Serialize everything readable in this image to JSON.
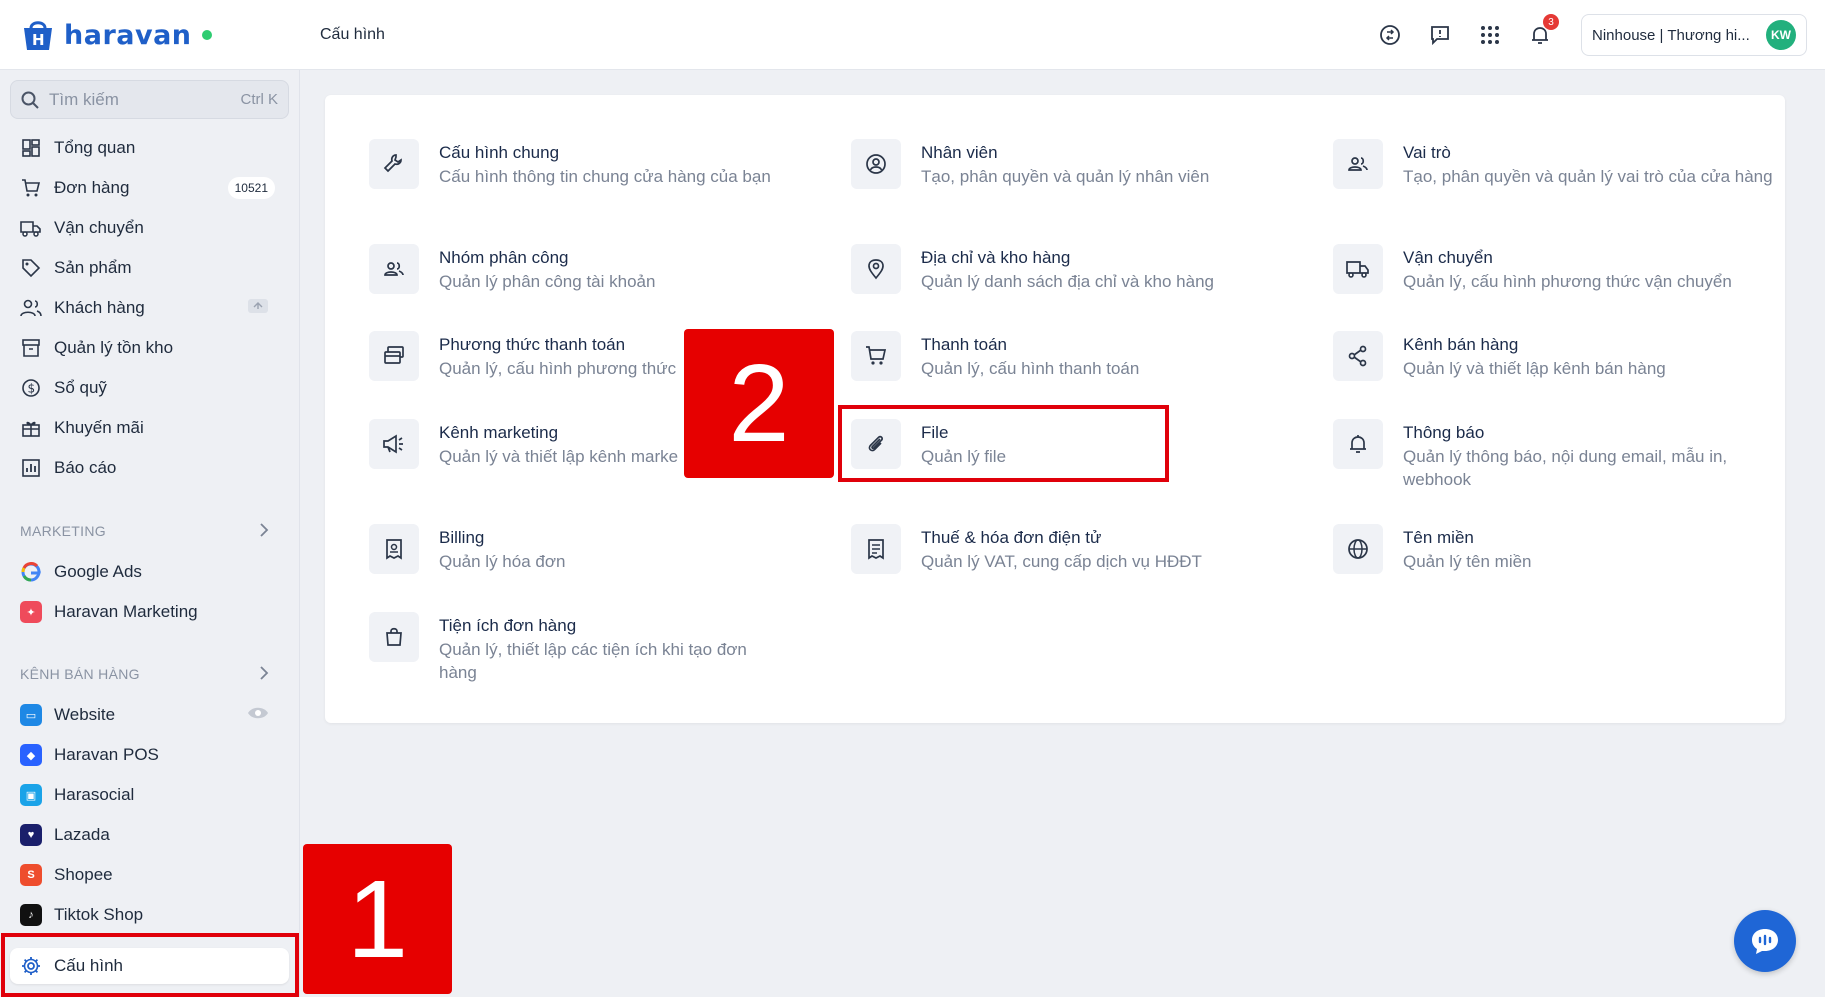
{
  "topbar": {
    "logo_text": "haravan",
    "page_title": "Cấu hình",
    "notification_count": "3",
    "store_name": "Ninhouse | Thương hi...",
    "avatar_initials": "KW"
  },
  "sidebar": {
    "search_placeholder": "Tìm kiếm",
    "search_hint": "Ctrl K",
    "items": [
      {
        "label": "Tổng quan"
      },
      {
        "label": "Đơn hàng",
        "badge": "10521"
      },
      {
        "label": "Vận chuyển"
      },
      {
        "label": "Sản phẩm"
      },
      {
        "label": "Khách hàng"
      },
      {
        "label": "Quản lý tồn kho"
      },
      {
        "label": "Sổ quỹ"
      },
      {
        "label": "Khuyến mãi"
      },
      {
        "label": "Báo cáo"
      }
    ],
    "marketing_label": "MARKETING",
    "marketing_items": [
      {
        "label": "Google Ads"
      },
      {
        "label": "Haravan Marketing"
      }
    ],
    "channels_label": "KÊNH BÁN HÀNG",
    "channel_items": [
      {
        "label": "Website"
      },
      {
        "label": "Haravan POS"
      },
      {
        "label": "Harasocial"
      },
      {
        "label": "Lazada"
      },
      {
        "label": "Shopee"
      },
      {
        "label": "Tiktok Shop"
      }
    ],
    "settings_label": "Cấu hình"
  },
  "settings": [
    {
      "title": "Cấu hình chung",
      "desc": "Cấu hình thông tin chung cửa hàng của bạn"
    },
    {
      "title": "Nhân viên",
      "desc": "Tạo, phân quyền và quản lý nhân viên"
    },
    {
      "title": "Vai trò",
      "desc": "Tạo, phân quyền và quản lý vai trò của cửa hàng"
    },
    {
      "title": "Nhóm phân công",
      "desc": "Quản lý phân công tài khoản"
    },
    {
      "title": "Địa chỉ và kho hàng",
      "desc": "Quản lý danh sách địa chỉ và kho hàng"
    },
    {
      "title": "Vận chuyển",
      "desc": "Quản lý, cấu hình phương thức vận chuyển"
    },
    {
      "title": "Phương thức thanh toán",
      "desc": "Quản lý, cấu hình phương thức"
    },
    {
      "title": "Thanh toán",
      "desc": "Quản lý, cấu hình thanh toán"
    },
    {
      "title": "Kênh bán hàng",
      "desc": "Quản lý và thiết lập kênh bán hàng"
    },
    {
      "title": "Kênh marketing",
      "desc": "Quản lý và thiết lập kênh marke"
    },
    {
      "title": "File",
      "desc": "Quản lý file"
    },
    {
      "title": "Thông báo",
      "desc": "Quản lý thông báo, nội dung email, mẫu in, webhook"
    },
    {
      "title": "Billing",
      "desc": "Quản lý hóa đơn"
    },
    {
      "title": "Thuế & hóa đơn điện tử",
      "desc": "Quản lý VAT, cung cấp dịch vụ HĐĐT"
    },
    {
      "title": "Tên miền",
      "desc": "Quản lý tên miền"
    },
    {
      "title": "Tiện ích đơn hàng",
      "desc": "Quản lý, thiết lập các tiện ích khi tạo đơn hàng"
    }
  ],
  "annotations": {
    "step1": "1",
    "step2": "2"
  },
  "colors": {
    "brand": "#1f5fc8",
    "annotation": "#e60000",
    "avatar": "#22b07d"
  }
}
